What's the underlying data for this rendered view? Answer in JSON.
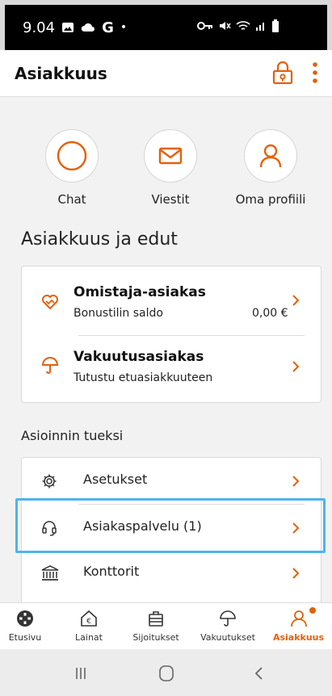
{
  "status_bar": {
    "time": "9.04",
    "icons": [
      "image-icon",
      "cloud-icon",
      "g-icon",
      "dot-icon",
      "key-icon",
      "mute-icon",
      "wifi-icon",
      "signal-icon",
      "battery-icon"
    ]
  },
  "header": {
    "title": "Asiakkuus",
    "accent_color": "#e2610b"
  },
  "quick_actions": [
    {
      "label": "Chat",
      "icon": "chat-circle-icon"
    },
    {
      "label": "Viestit",
      "icon": "envelope-icon"
    },
    {
      "label": "Oma profiili",
      "icon": "person-icon"
    }
  ],
  "benefits": {
    "title": "Asiakkuus ja edut",
    "items": [
      {
        "title": "Omistaja-asiakas",
        "subtitle": "Bonustilin saldo",
        "amount": "0,00 €",
        "icon": "handshake-heart-icon"
      },
      {
        "title": "Vakuutusasiakas",
        "subtitle": "Tutustu etuasiakkuuteen",
        "icon": "umbrella-icon"
      }
    ]
  },
  "support": {
    "title": "Asioinnin tueksi",
    "items": [
      {
        "label": "Asetukset",
        "icon": "gear-icon"
      },
      {
        "label": "Asiakaspalvelu (1)",
        "icon": "headset-icon"
      },
      {
        "label": "Konttorit",
        "icon": "bank-icon"
      }
    ]
  },
  "bottom_nav": {
    "items": [
      {
        "label": "Etusivu",
        "icon": "home-logo-icon"
      },
      {
        "label": "Lainat",
        "icon": "house-euro-icon"
      },
      {
        "label": "Sijoitukset",
        "icon": "briefcase-icon"
      },
      {
        "label": "Vakuutukset",
        "icon": "umbrella-icon"
      },
      {
        "label": "Asiakkuus",
        "icon": "person-icon",
        "active": true
      }
    ]
  }
}
